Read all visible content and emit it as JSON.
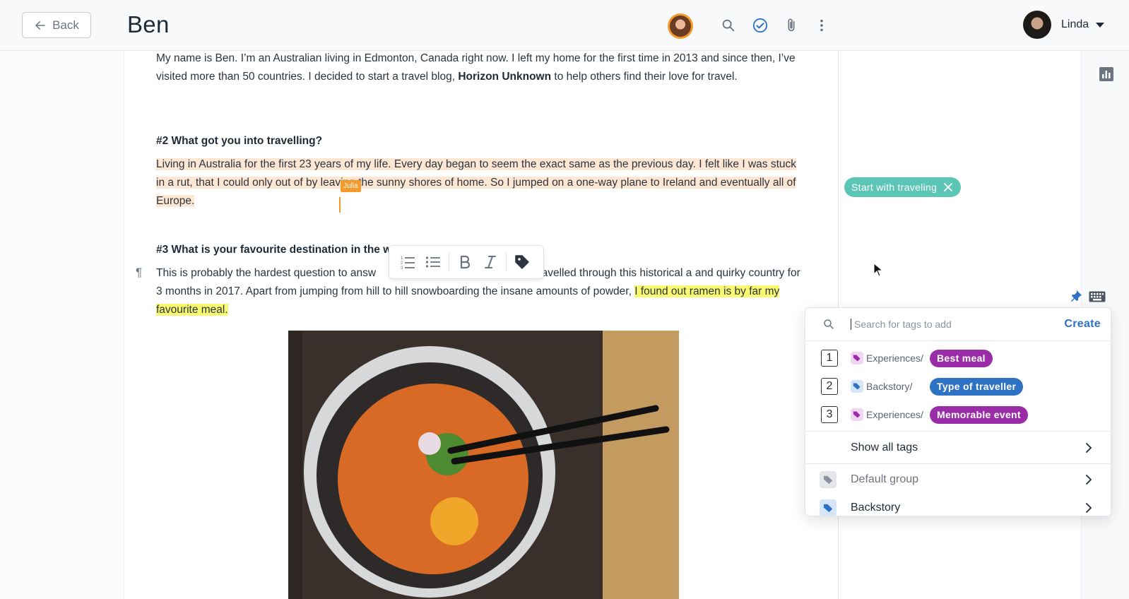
{
  "header": {
    "back_label": "Back",
    "doc_title": "Ben",
    "user_name": "Linda"
  },
  "document": {
    "intro": {
      "before_bold": "My name is Ben. I’m an Australian living in Edmonton, Canada right now. I left my home for the first time in 2013 and since then, I’ve visited more than 50 countries. I decided to start a travel blog, ",
      "bold": "Horizon Unknown",
      "after_bold": " to help others find their love for travel."
    },
    "q2_heading": "#2 What got you into travelling?",
    "q2_answer_a": "Living in Australia for the first 23 years of my life. Every day began to seem the exact same as the previous day. I felt like I was stuck in a rut, that I could only",
    "q2_answer_b": " out of by leaving the sunny shores of home. So I jumped on a one-way plane to Ireland and eventually all of Europe.",
    "collaborator_label": "Julia",
    "q3_heading": "#3 What is your favourite destination in the wo",
    "q3_answer_a": "This is probably the hardest question to answ",
    "q3_answer_b": "pan. I travelled through this historical a and quirky country for 3 months in 2017. Apart from jumping from hill to hill snowboarding the insane amounts of powder, ",
    "q3_highlight": "I found out ramen is by far my favourite meal.",
    "pilcrow": "¶"
  },
  "toolbar": {
    "icons": [
      "ordered-list-icon",
      "bullet-list-icon",
      "bold-icon",
      "italic-icon",
      "tag-icon"
    ]
  },
  "applied_tag": {
    "label": "Start with traveling",
    "color": "#5cc6b6"
  },
  "tag_popup": {
    "search_placeholder": "Search for tags to add",
    "create_label": "Create",
    "suggestions": [
      {
        "num": "1",
        "group": "Experiences/",
        "tag": "Best meal",
        "color": "#9b2ca8"
      },
      {
        "num": "2",
        "group": "Backstory/",
        "tag": "Type of traveller",
        "color": "#2d72c4"
      },
      {
        "num": "3",
        "group": "Experiences/",
        "tag": "Memorable event",
        "color": "#9b2ca8"
      }
    ],
    "show_all_label": "Show all tags",
    "groups": [
      {
        "label": "Default group",
        "color": "#8b949e"
      },
      {
        "label": "Backstory",
        "color": "#2d72c4"
      }
    ]
  }
}
